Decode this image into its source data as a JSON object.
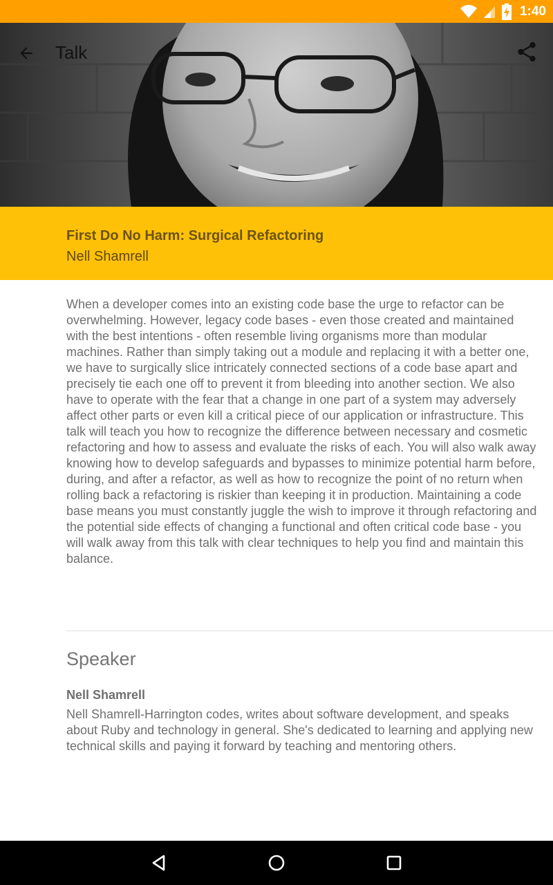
{
  "status_bar": {
    "time": "1:40",
    "icons": [
      "wifi-icon",
      "cell-signal-icon",
      "battery-charging-icon"
    ]
  },
  "app_bar": {
    "title": "Talk",
    "back_icon": "arrow-back-icon",
    "share_icon": "share-icon"
  },
  "talk": {
    "title": "First Do No Harm: Surgical Refactoring",
    "speaker": "Nell Shamrell",
    "abstract": "When a developer comes into an existing code base the urge to refactor can be overwhelming. However, legacy code bases - even those created and maintained with the best intentions - often resemble living organisms more than modular machines. Rather than simply taking out a module and replacing it with a better one, we have to surgically slice intricately connected sections of a code base apart and precisely tie each one off to prevent it from bleeding into another section. We also have to operate with the fear that a change in one part of a system may adversely affect other parts or even kill a critical piece of our application or infrastructure. This talk will teach you how to recognize the difference between necessary and cosmetic refactoring and how to assess and evaluate the risks of each. You will also walk away knowing how to develop safeguards and bypasses to minimize potential harm before, during, and after a refactor, as well as how to recognize the point of no return when rolling back a refactoring is riskier than keeping it in production. Maintaining a code base means you must constantly juggle the wish to improve it through refactoring and the potential side effects of changing a functional and often critical code base - you will walk away from this talk with clear techniques to help you find and maintain this balance."
  },
  "speaker_section": {
    "heading": "Speaker",
    "name": "Nell Shamrell",
    "bio": "Nell Shamrell-Harrington codes, writes about software development, and speaks about Ruby and technology in general. She's dedicated to learning and applying new technical skills and paying it forward by teaching and mentoring others."
  },
  "nav_bar": {
    "icons": [
      "back-triangle-icon",
      "home-circle-icon",
      "recents-square-icon"
    ]
  },
  "colors": {
    "status_bar": "#FFA000",
    "accent_band": "#FFC107",
    "body_text": "#6f6f6f"
  }
}
